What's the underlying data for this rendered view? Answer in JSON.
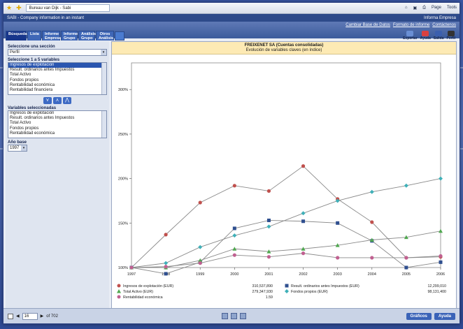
{
  "browser": {
    "tab_title": "Bureau van Dijk - Sabi",
    "page_label": "Page",
    "tools_label": "Tools"
  },
  "app": {
    "header_left": "SABI - Company information in an instant",
    "header_right": "Informa Empresa",
    "links": [
      "Cambiar Base de Datos",
      "Formato de informe",
      "Contáctenos"
    ]
  },
  "tabs": [
    {
      "label": "Búsqueda"
    },
    {
      "label": "Lista"
    },
    {
      "label": "Informe Empresa"
    },
    {
      "label": "Informe Grupo"
    },
    {
      "label": "Análisis Grupo"
    },
    {
      "label": "Otros Análisis"
    }
  ],
  "tools": [
    "Exportar",
    "Ayuda",
    "Salida",
    "Perfil"
  ],
  "left": {
    "section_label": "Seleccione una sección",
    "section_value": "Perfil",
    "variables_label": "Seleccione 1 a 5 variables",
    "variables": [
      "Ingresos de explotación",
      "Result. ordinarios antes Impuestos",
      "Total Activo",
      "Fondos propios",
      "Rentabilidad económica",
      "Rentabilidad financiera"
    ],
    "selected_label": "Variables seleccionadas",
    "selected": [
      "Ingresos de explotación",
      "Result. ordinarios antes Impuestos",
      "Total Activo",
      "Fondos propios",
      "Rentabilidad económica"
    ],
    "base_year_label": "Año base",
    "base_year_value": "1997"
  },
  "chart_title": "FREIXENET SA (Cuentas consolidadas)",
  "chart_subtitle": "Evolución de variables claves (en índice)",
  "legend": [
    {
      "label": "Ingresos de explotación (EUR)",
      "value": "310,537,890",
      "color": "#c0504d",
      "marker": "circle"
    },
    {
      "label": "Result. ordinarios antes Impuestos (EUR)",
      "value": "12,299,010",
      "color": "#2f4f8f",
      "marker": "square"
    },
    {
      "label": "Total Activo (EUR)",
      "value": "279,347,930",
      "color": "#4fa84f",
      "marker": "triangle"
    },
    {
      "label": "Fondos propios (EUR)",
      "value": "98,131,400",
      "color": "#3fb0b8",
      "marker": "diamond"
    },
    {
      "label": "Rentabilidad económica",
      "value": "1.59",
      "color": "#c06090",
      "marker": "circle"
    }
  ],
  "chart_data": {
    "type": "line",
    "x": [
      "1997",
      "1998",
      "1999",
      "2000",
      "2001",
      "2002",
      "2003",
      "2004",
      "2005",
      "2006"
    ],
    "ytick_labels": [
      "100%",
      "150%",
      "200%",
      "250%",
      "300%"
    ],
    "ylim": [
      100,
      330
    ],
    "series": [
      {
        "name": "Ingresos de explotación (EUR)",
        "color": "#c0504d",
        "marker": "circle",
        "values": [
          100,
          137,
          173,
          192,
          186,
          214,
          177,
          151,
          111,
          112
        ]
      },
      {
        "name": "Result. ordinarios antes Impuestos (EUR)",
        "color": "#2f4f8f",
        "marker": "square",
        "values": [
          100,
          93,
          106,
          144,
          153,
          152,
          150,
          130,
          100,
          106
        ]
      },
      {
        "name": "Total Activo (EUR)",
        "color": "#4fa84f",
        "marker": "triangle",
        "values": [
          100,
          100,
          108,
          121,
          118,
          121,
          125,
          131,
          134,
          141
        ]
      },
      {
        "name": "Fondos propios (EUR)",
        "color": "#3fb0b8",
        "marker": "diamond",
        "values": [
          100,
          105,
          123,
          136,
          146,
          161,
          175,
          185,
          192,
          200
        ]
      },
      {
        "name": "Rentabilidad económica",
        "color": "#c06090",
        "marker": "circle",
        "values": [
          100,
          101,
          105,
          114,
          112,
          116,
          111,
          111,
          111,
          113
        ]
      }
    ]
  },
  "bottom": {
    "page_value": "16",
    "page_total": "of 702",
    "graficos": "Gráficos",
    "ayuda": "Ayuda"
  }
}
